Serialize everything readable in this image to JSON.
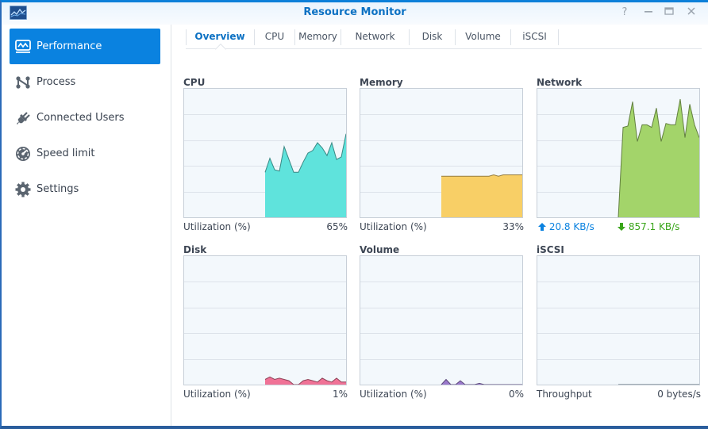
{
  "window": {
    "title": "Resource Monitor",
    "controls": [
      "help",
      "minimize",
      "maximize",
      "close"
    ],
    "control_glyphs": {
      "help": "?",
      "minimize": "—",
      "maximize": "▭",
      "close": "✕"
    }
  },
  "sidebar": {
    "items": [
      {
        "label": "Performance",
        "icon": "performance-icon",
        "active": true
      },
      {
        "label": "Process",
        "icon": "process-icon",
        "active": false
      },
      {
        "label": "Connected Users",
        "icon": "plug-icon",
        "active": false
      },
      {
        "label": "Speed limit",
        "icon": "speedometer-icon",
        "active": false
      },
      {
        "label": "Settings",
        "icon": "gear-icon",
        "active": false
      }
    ]
  },
  "tabs": [
    {
      "label": "Overview",
      "active": true
    },
    {
      "label": "CPU",
      "active": false
    },
    {
      "label": "Memory",
      "active": false
    },
    {
      "label": "Network",
      "active": false
    },
    {
      "label": "Disk",
      "active": false
    },
    {
      "label": "Volume",
      "active": false
    },
    {
      "label": "iSCSI",
      "active": false
    }
  ],
  "colors": {
    "accent": "#0a82e0",
    "cpu": "#5fe3dc",
    "memory": "#f8cf66",
    "network": "#a3d46a",
    "disk": "#f07296",
    "volume": "#9a79cc",
    "iscsi": "#8aa0b6",
    "upload": "#0a82e0",
    "download": "#3aa51a"
  },
  "panels": {
    "cpu": {
      "title": "CPU",
      "footer_label": "Utilization (%)",
      "footer_value": "65%"
    },
    "memory": {
      "title": "Memory",
      "footer_label": "Utilization (%)",
      "footer_value": "33%"
    },
    "network": {
      "title": "Network",
      "upload": "20.8 KB/s",
      "download": "857.1 KB/s"
    },
    "disk": {
      "title": "Disk",
      "footer_label": "Utilization (%)",
      "footer_value": "1%"
    },
    "volume": {
      "title": "Volume",
      "footer_label": "Utilization (%)",
      "footer_value": "0%"
    },
    "iscsi": {
      "title": "iSCSI",
      "footer_label": "Throughput",
      "footer_value": "0 bytes/s"
    }
  },
  "chart_data": [
    {
      "type": "area",
      "title": "CPU",
      "ylabel": "Utilization (%)",
      "ylim": [
        0,
        100
      ],
      "grid": true,
      "x_start_fraction": 0.5,
      "series": [
        {
          "name": "CPU",
          "color": "#5fe3dc",
          "values": [
            35,
            46,
            37,
            36,
            55,
            45,
            35,
            35,
            43,
            50,
            52,
            58,
            54,
            48,
            58,
            45,
            47,
            65
          ]
        }
      ]
    },
    {
      "type": "area",
      "title": "Memory",
      "ylabel": "Utilization (%)",
      "ylim": [
        0,
        100
      ],
      "grid": true,
      "x_start_fraction": 0.5,
      "series": [
        {
          "name": "Memory",
          "color": "#f8cf66",
          "values": [
            32,
            32,
            32,
            32,
            32,
            32,
            32,
            32,
            32,
            32,
            32,
            33,
            32,
            33,
            33,
            33,
            33,
            33
          ]
        }
      ]
    },
    {
      "type": "area",
      "title": "Network",
      "ylim": [
        0,
        100
      ],
      "grid": true,
      "x_start_fraction": 0.5,
      "series": [
        {
          "name": "Network",
          "color": "#a3d46a",
          "values": [
            0,
            70,
            71,
            90,
            59,
            72,
            72,
            70,
            85,
            59,
            73,
            72,
            72,
            92,
            62,
            88,
            72,
            62
          ]
        }
      ]
    },
    {
      "type": "area",
      "title": "Disk",
      "ylabel": "Utilization (%)",
      "ylim": [
        0,
        100
      ],
      "grid": true,
      "x_start_fraction": 0.5,
      "series": [
        {
          "name": "Disk",
          "color": "#f07296",
          "values": [
            4,
            6,
            4,
            5,
            4,
            3,
            0,
            0,
            3,
            4,
            3,
            2,
            5,
            3,
            2,
            5,
            2,
            2
          ]
        }
      ]
    },
    {
      "type": "area",
      "title": "Volume",
      "ylabel": "Utilization (%)",
      "ylim": [
        0,
        100
      ],
      "grid": true,
      "x_start_fraction": 0.5,
      "series": [
        {
          "name": "Volume",
          "color": "#9a79cc",
          "values": [
            0,
            4,
            0,
            0,
            3,
            0,
            0,
            0,
            1,
            0,
            0,
            0,
            0,
            0,
            0,
            0,
            0,
            0
          ]
        }
      ]
    },
    {
      "type": "area",
      "title": "iSCSI",
      "ylabel": "Throughput",
      "ylim": [
        0,
        100
      ],
      "grid": true,
      "x_start_fraction": 0.5,
      "series": [
        {
          "name": "iSCSI",
          "color": "#8aa0b6",
          "values": [
            0,
            0,
            0,
            0,
            0,
            0,
            0,
            0,
            0,
            0,
            0,
            0,
            0,
            0,
            0,
            0,
            0,
            0
          ]
        }
      ]
    }
  ]
}
